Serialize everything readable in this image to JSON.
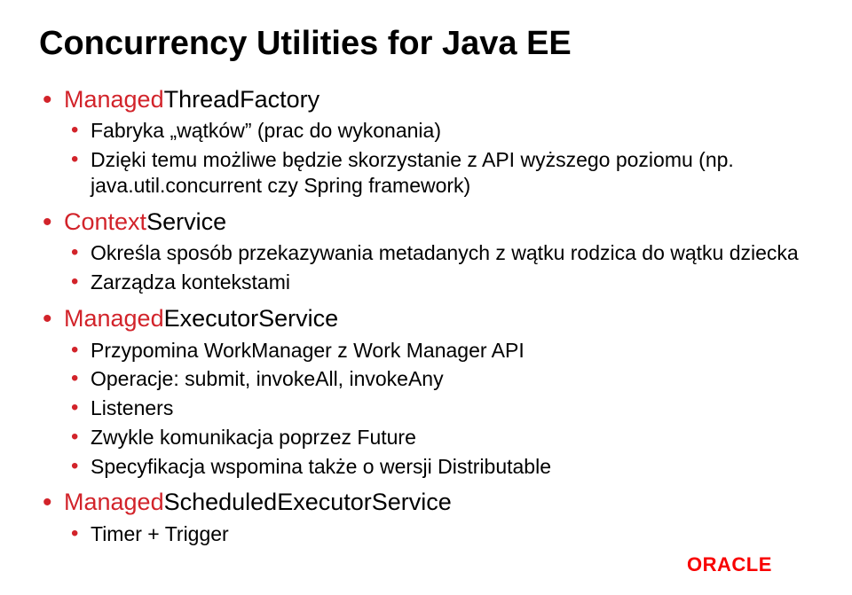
{
  "slide": {
    "title": "Concurrency Utilities for Java EE",
    "items": [
      {
        "api_prefix": "Managed",
        "api_rest": "ThreadFactory",
        "sub": [
          {
            "text": "Fabryka „wątków” (prac do wykonania)"
          },
          {
            "text": "Dzięki temu możliwe będzie skorzystanie z API wyższego poziomu (np. java.util.concurrent czy Spring framework)"
          }
        ]
      },
      {
        "api_prefix": "Context",
        "api_rest": "Service",
        "sub": [
          {
            "text": "Określa sposób przekazywania metadanych z wątku rodzica do wątku dziecka"
          },
          {
            "text": "Zarządza kontekstami"
          }
        ]
      },
      {
        "api_prefix": "Managed",
        "api_rest": "ExecutorService",
        "sub": [
          {
            "text": "Przypomina WorkManager z Work Manager API"
          },
          {
            "text": "Operacje: submit, invokeAll, invokeAny"
          },
          {
            "text": "Listeners"
          },
          {
            "text": "Zwykle komunikacja poprzez Future"
          },
          {
            "text": "Specyfikacja wspomina także o wersji Distributable"
          }
        ]
      },
      {
        "api_prefix": "Managed",
        "api_rest": "ScheduledExecutorService",
        "sub": [
          {
            "text": "Timer + Trigger"
          }
        ]
      }
    ]
  },
  "logo": {
    "name": "ORACLE",
    "color": "#f80000"
  }
}
